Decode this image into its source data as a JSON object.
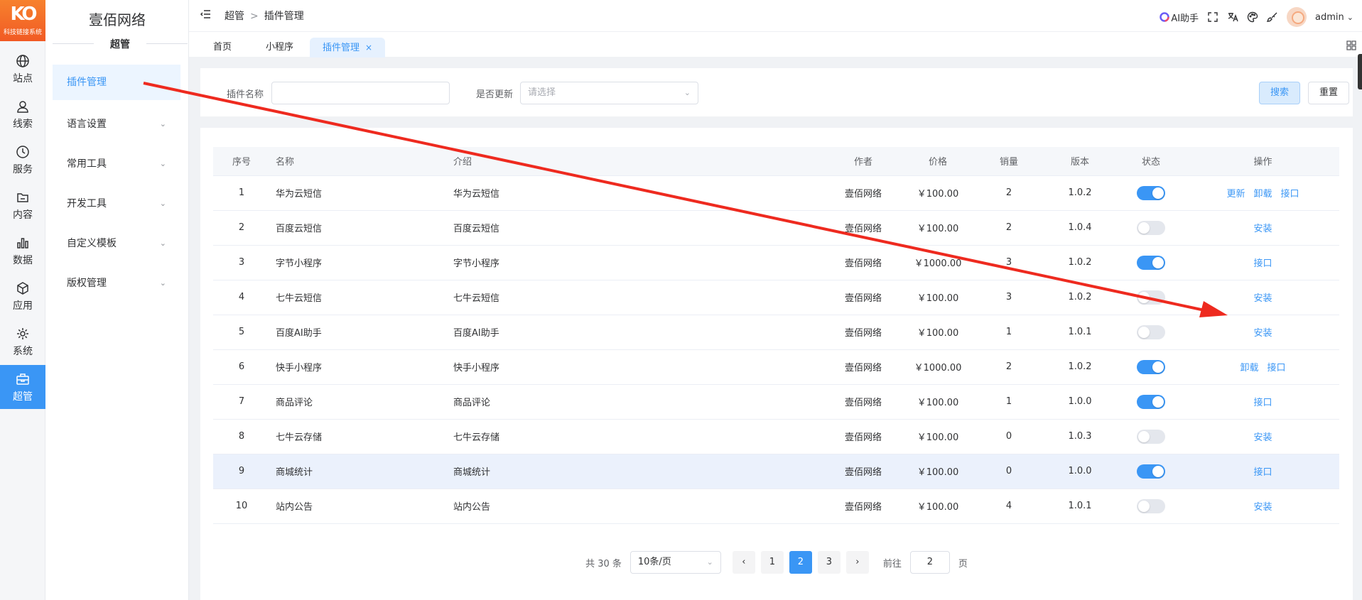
{
  "logo": {
    "mark": "KO",
    "sub": "科技链接系统"
  },
  "rail": [
    {
      "label": "站点",
      "icon": "globe-icon"
    },
    {
      "label": "线索",
      "icon": "user-icon"
    },
    {
      "label": "服务",
      "icon": "clock-icon"
    },
    {
      "label": "内容",
      "icon": "folder-icon"
    },
    {
      "label": "数据",
      "icon": "bar-chart-icon"
    },
    {
      "label": "应用",
      "icon": "cube-icon"
    },
    {
      "label": "系统",
      "icon": "gear-icon"
    },
    {
      "label": "超管",
      "icon": "toolbox-icon",
      "active": true
    }
  ],
  "submenu": {
    "brand": "壹佰网络",
    "group": "超管",
    "items": [
      {
        "label": "插件管理",
        "active": true
      },
      {
        "label": "语言设置"
      },
      {
        "label": "常用工具"
      },
      {
        "label": "开发工具"
      },
      {
        "label": "自定义模板"
      },
      {
        "label": "版权管理"
      }
    ]
  },
  "header": {
    "breadcrumb": [
      "超管",
      "插件管理"
    ],
    "sep": ">",
    "ai_label": "AI助手",
    "username": "admin"
  },
  "tabs": [
    {
      "label": "首页"
    },
    {
      "label": "小程序"
    },
    {
      "label": "插件管理",
      "active": true,
      "close": "×"
    }
  ],
  "search": {
    "name_label": "插件名称",
    "name_value": "",
    "update_label": "是否更新",
    "update_placeholder": "请选择",
    "search_btn": "搜索",
    "reset_btn": "重置"
  },
  "table": {
    "columns": [
      "序号",
      "名称",
      "介绍",
      "作者",
      "价格",
      "销量",
      "版本",
      "状态",
      "操作"
    ],
    "rows": [
      {
        "no": "1",
        "name": "华为云短信",
        "intro": "华为云短信",
        "author": "壹佰网络",
        "price": "￥100.00",
        "sales": "2",
        "version": "1.0.2",
        "on": true,
        "ops": [
          "更新",
          "卸载",
          "接口"
        ]
      },
      {
        "no": "2",
        "name": "百度云短信",
        "intro": "百度云短信",
        "author": "壹佰网络",
        "price": "￥100.00",
        "sales": "2",
        "version": "1.0.4",
        "on": false,
        "ops": [
          "安装"
        ]
      },
      {
        "no": "3",
        "name": "字节小程序",
        "intro": "字节小程序",
        "author": "壹佰网络",
        "price": "￥1000.00",
        "sales": "3",
        "version": "1.0.2",
        "on": true,
        "ops": [
          "接口"
        ]
      },
      {
        "no": "4",
        "name": "七牛云短信",
        "intro": "七牛云短信",
        "author": "壹佰网络",
        "price": "￥100.00",
        "sales": "3",
        "version": "1.0.2",
        "on": false,
        "ops": [
          "安装"
        ]
      },
      {
        "no": "5",
        "name": "百度AI助手",
        "intro": "百度AI助手",
        "author": "壹佰网络",
        "price": "￥100.00",
        "sales": "1",
        "version": "1.0.1",
        "on": false,
        "ops": [
          "安装"
        ]
      },
      {
        "no": "6",
        "name": "快手小程序",
        "intro": "快手小程序",
        "author": "壹佰网络",
        "price": "￥1000.00",
        "sales": "2",
        "version": "1.0.2",
        "on": true,
        "ops": [
          "卸载",
          "接口"
        ]
      },
      {
        "no": "7",
        "name": "商品评论",
        "intro": "商品评论",
        "author": "壹佰网络",
        "price": "￥100.00",
        "sales": "1",
        "version": "1.0.0",
        "on": true,
        "ops": [
          "接口"
        ]
      },
      {
        "no": "8",
        "name": "七牛云存储",
        "intro": "七牛云存储",
        "author": "壹佰网络",
        "price": "￥100.00",
        "sales": "0",
        "version": "1.0.3",
        "on": false,
        "ops": [
          "安装"
        ]
      },
      {
        "no": "9",
        "name": "商城统计",
        "intro": "商城统计",
        "author": "壹佰网络",
        "price": "￥100.00",
        "sales": "0",
        "version": "1.0.0",
        "on": true,
        "ops": [
          "接口"
        ],
        "highlight": true
      },
      {
        "no": "10",
        "name": "站内公告",
        "intro": "站内公告",
        "author": "壹佰网络",
        "price": "￥100.00",
        "sales": "4",
        "version": "1.0.1",
        "on": false,
        "ops": [
          "安装"
        ]
      }
    ]
  },
  "pagination": {
    "total_text": "共 30 条",
    "page_size": "10条/页",
    "pages": [
      "1",
      "2",
      "3"
    ],
    "current": "2",
    "goto_label": "前往",
    "goto_value": "2",
    "page_suffix": "页"
  },
  "annotation_color": "#ee2a1f",
  "accent": "#3a96f5"
}
